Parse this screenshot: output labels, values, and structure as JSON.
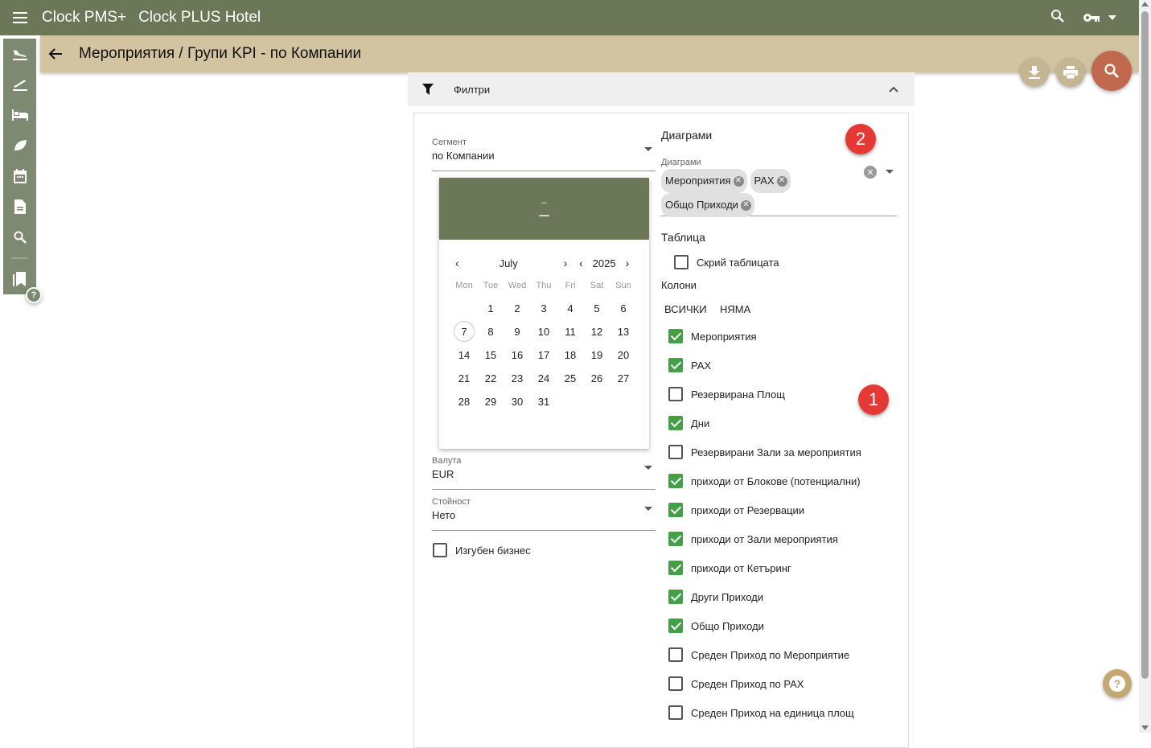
{
  "app": {
    "brand": "Clock PMS+",
    "hotel": "Clock PLUS Hotel"
  },
  "page": {
    "title": "Мероприятия / Групи KPI - по Компании"
  },
  "filters": {
    "label": "Филтри"
  },
  "segment": {
    "label": "Сегмент",
    "value": "по Компании"
  },
  "calendar": {
    "header_line1": "–",
    "header_line2": "–",
    "month": "July",
    "year": "2025",
    "weekdays": [
      "Mon",
      "Tue",
      "Wed",
      "Thu",
      "Fri",
      "Sat",
      "Sun"
    ],
    "today": "7"
  },
  "currency": {
    "label": "Валута",
    "value": "EUR"
  },
  "value_type": {
    "label": "Стойност",
    "value": "Нето"
  },
  "lost_business": {
    "label": "Изгубен бизнес",
    "checked": false
  },
  "charts": {
    "heading": "Диаграми",
    "field_label": "Диаграми",
    "chips": [
      "Мероприятия",
      "PAX",
      "Общо Приходи"
    ]
  },
  "table": {
    "heading": "Таблица",
    "hide_label": "Скрий таблицата",
    "columns_label": "Колони",
    "all_button": "ВСИЧКИ",
    "none_button": "НЯМА",
    "columns": [
      {
        "label": "Мероприятия",
        "checked": true
      },
      {
        "label": "PAX",
        "checked": true
      },
      {
        "label": "Резервирана Площ",
        "checked": false
      },
      {
        "label": "Дни",
        "checked": true
      },
      {
        "label": "Резервирани Зали за мероприятия",
        "checked": false
      },
      {
        "label": "приходи от Блокове (потенциални)",
        "checked": true
      },
      {
        "label": "приходи от Резервации",
        "checked": true
      },
      {
        "label": "приходи от Зали мероприятия",
        "checked": true
      },
      {
        "label": "приходи от Кетъринг",
        "checked": true
      },
      {
        "label": "Други Приходи",
        "checked": true
      },
      {
        "label": "Общо Приходи",
        "checked": true
      },
      {
        "label": "Среден Приход по Мероприятие",
        "checked": false
      },
      {
        "label": "Среден Приход по PAX",
        "checked": false
      },
      {
        "label": "Среден Приход на единица площ",
        "checked": false
      }
    ]
  },
  "annotations": {
    "badge1": "1",
    "badge2": "2"
  },
  "icons": {
    "menu": "menu-icon",
    "search": "search-icon",
    "key": "key-icon",
    "back": "arrow-back-icon",
    "download": "download-icon",
    "print": "print-icon",
    "filter": "filter-icon",
    "help": "help-icon"
  },
  "colors": {
    "primary": "#6b7757",
    "subbar": "#d2c4a0",
    "accent": "#c1694f",
    "check": "#43a047",
    "badge": "#e53935"
  }
}
